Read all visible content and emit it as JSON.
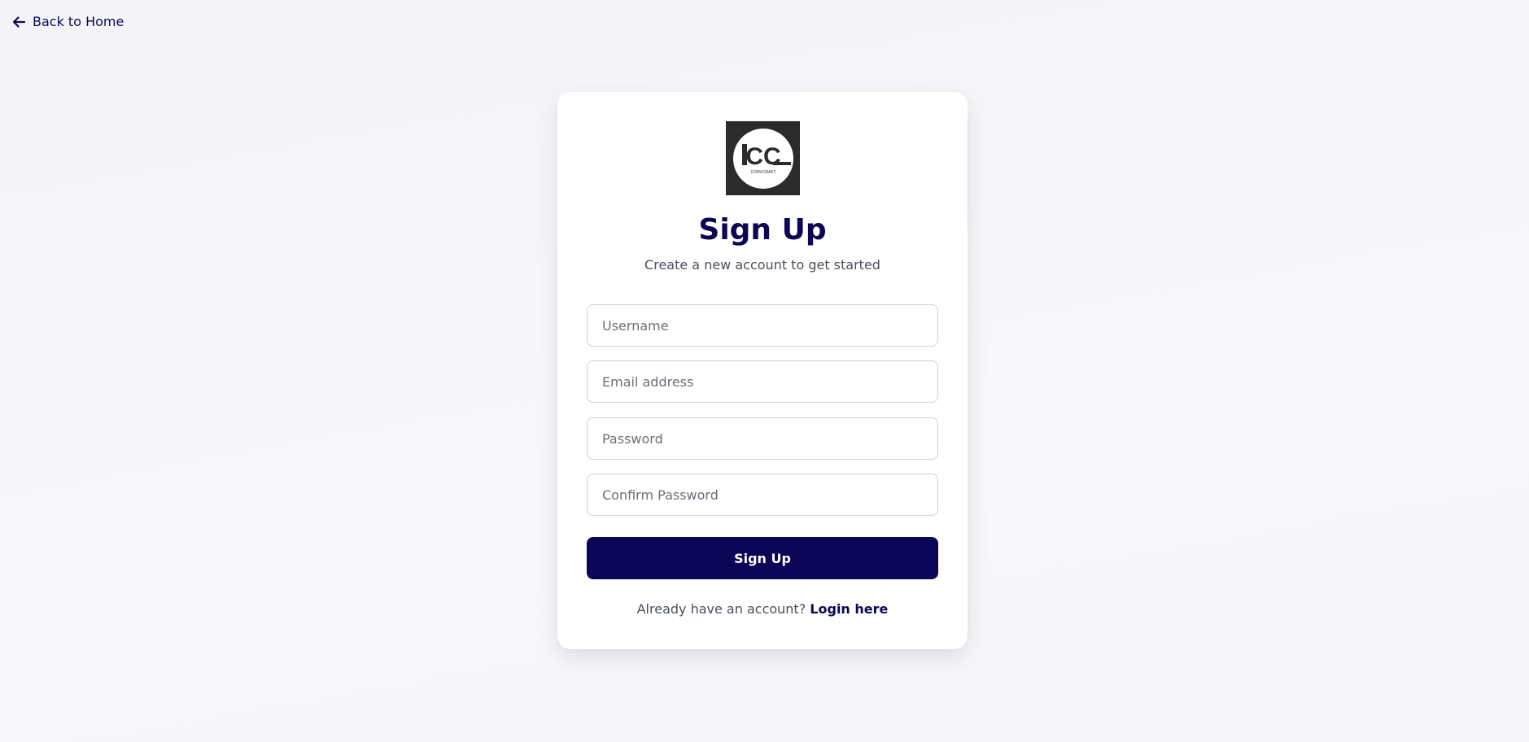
{
  "nav": {
    "back_label": "Back to Home",
    "back_icon": "arrow-left-icon"
  },
  "brand": {
    "logo_letters": "CC",
    "logo_tagline": "CONVCRAFT"
  },
  "signup": {
    "title": "Sign Up",
    "subtitle": "Create a new account to get started",
    "username_placeholder": "Username",
    "email_placeholder": "Email address",
    "password_placeholder": "Password",
    "confirm_password_placeholder": "Confirm Password",
    "submit_label": "Sign Up",
    "footer_text": "Already have an account?",
    "login_link_label": "Login here"
  },
  "colors": {
    "primary": "#0b0457",
    "title": "#0c0755",
    "muted_text": "#4a4f5c",
    "background": "#f6f6f8",
    "logo_bg": "#2b2b2b"
  }
}
